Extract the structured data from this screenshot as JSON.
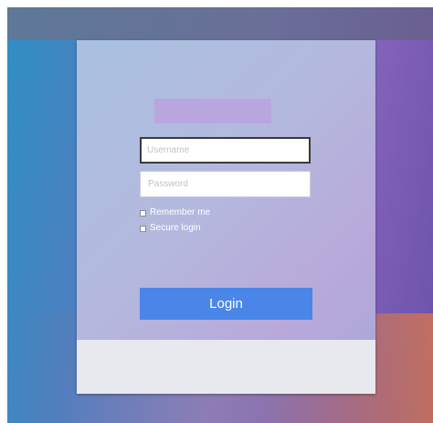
{
  "login_form": {
    "username_placeholder": "Username",
    "password_placeholder": "Password",
    "remember_label": "Remember me",
    "secure_label": "Secure login",
    "login_label": "Login"
  },
  "icons": {
    "checkbox": "checkbox-icon"
  },
  "colors": {
    "login_button": "#4a86e8",
    "logo_placeholder": "#b9a6e0",
    "footer": "#e7e9ef"
  }
}
